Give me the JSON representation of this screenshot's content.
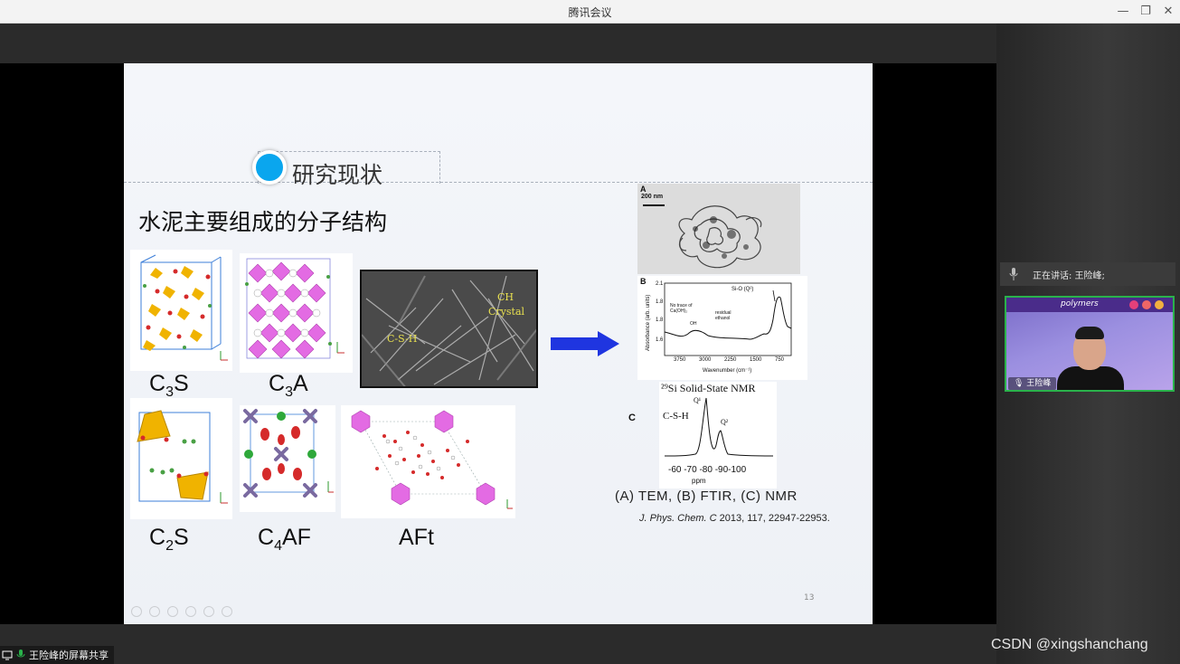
{
  "window": {
    "title": "腾讯会议"
  },
  "slide": {
    "section_title": "研究现状",
    "heading": "水泥主要组成的分子结构",
    "structures": [
      {
        "base": "C",
        "sub": "3",
        "tail": "S"
      },
      {
        "base": "C",
        "sub": "3",
        "tail": "A"
      },
      {
        "base": "C",
        "sub": "2",
        "tail": "S"
      },
      {
        "base": "C",
        "sub": "4",
        "tail": "AF"
      },
      {
        "base": "AFt",
        "sub": "",
        "tail": ""
      }
    ],
    "sem_labels": {
      "ch": "CH",
      "crystal": "Crystal",
      "csh": "C-S-H"
    },
    "figure": {
      "panel_a": "A",
      "scale": "200 nm",
      "panel_b": "B",
      "ftir_ylabel": "Absorbance (arb. units)",
      "ftir_xlabel": "Wavenumber (cm⁻¹)",
      "ftir_xticks": [
        "3750",
        "3000",
        "2250",
        "1500",
        "750"
      ],
      "ftir_yticks": [
        "2.1",
        "1.8",
        "1.8",
        "1.6"
      ],
      "ftir_notes": [
        "No trace of Ca(OH)₂",
        "OH",
        "residual ethanol",
        "Si-O (Q²)"
      ],
      "panel_c": "C",
      "nmr_title": "²⁹Si Solid-State NMR",
      "nmr_csh": "C-S-H",
      "nmr_q1": "Q¹",
      "nmr_q2": "Q²",
      "nmr_xticks": "-60 -70 -80 -90-100",
      "nmr_xunit": "ppm"
    },
    "caption": "(A) TEM,  (B) FTIR,  (C) NMR",
    "citation_journal": "J. Phys. Chem. C",
    "citation_rest": " 2013, 117, 22947-22953.",
    "page_number": "13"
  },
  "sidebar": {
    "speaking_label": "正在讲话: 王险峰;",
    "participant_name": "王险峰",
    "video_banner": "polymers"
  },
  "footer": {
    "share_label": "王险峰的屏幕共享",
    "watermark": "CSDN @xingshanchang"
  },
  "colors": {
    "accent_dot": "#0aa6ee",
    "arrow": "#1f35e0",
    "video_border": "#2ab24b"
  }
}
